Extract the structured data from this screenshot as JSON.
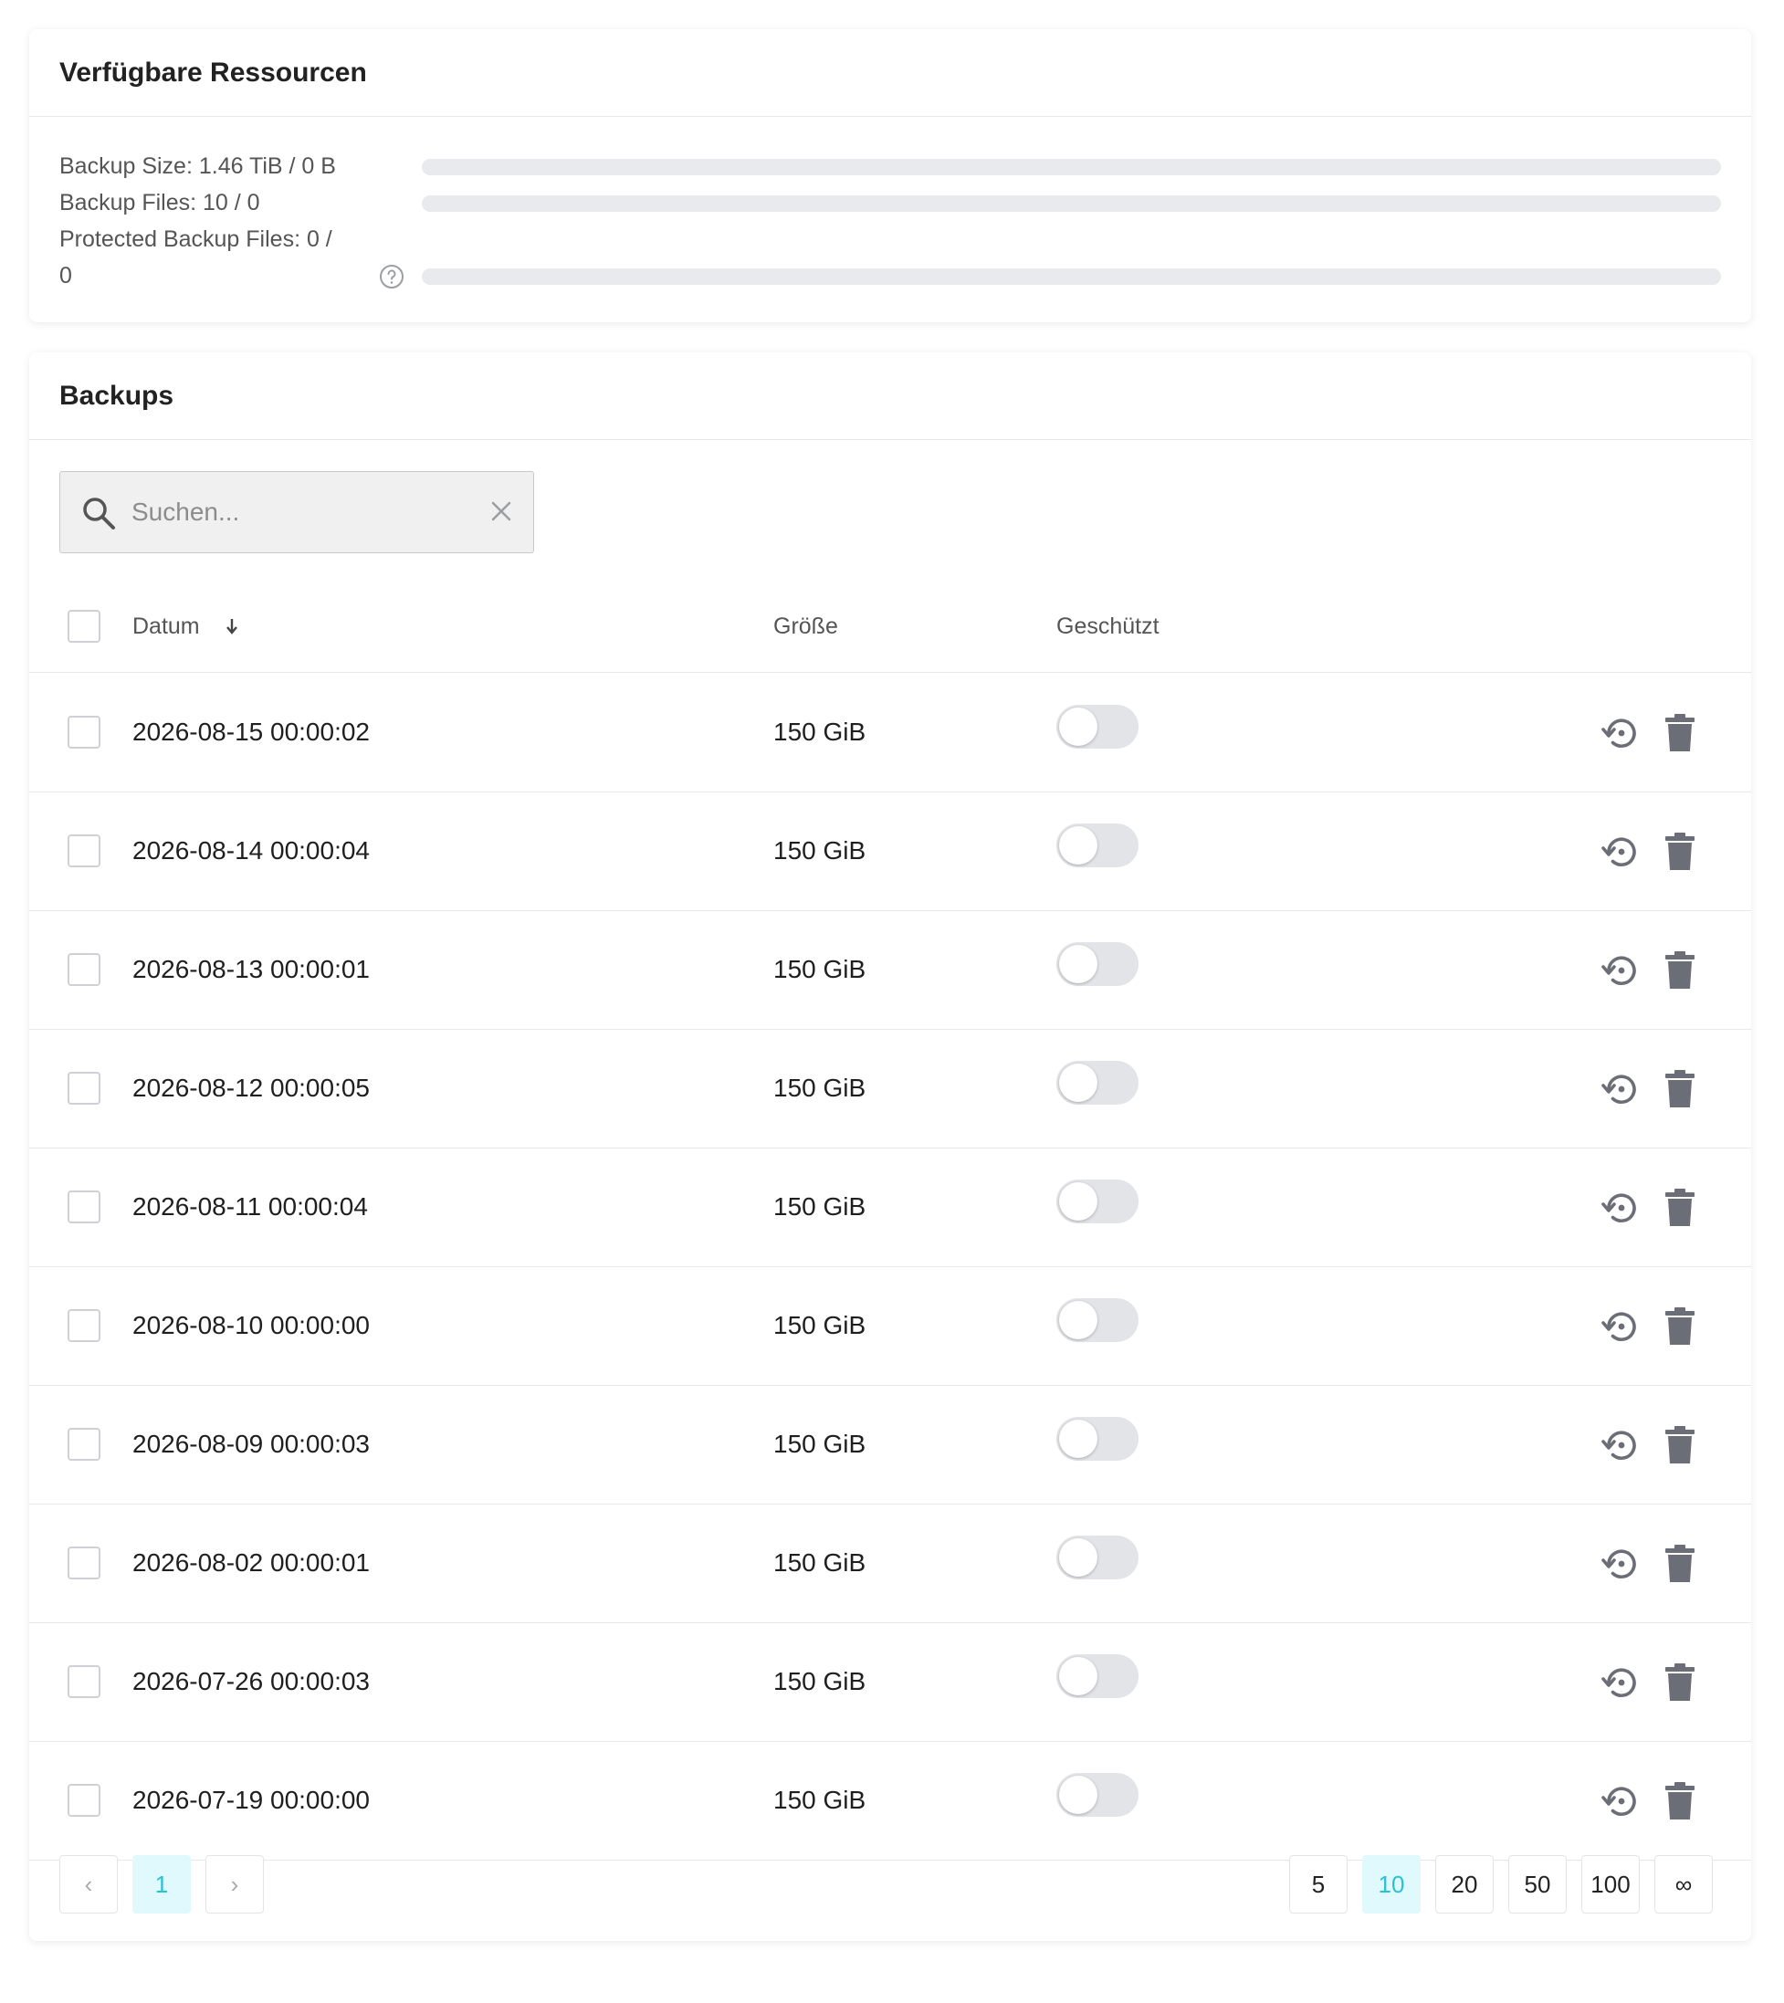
{
  "resources": {
    "title": "Verfügbare Ressourcen",
    "rows": [
      {
        "label": "Backup Size: 1.46 TiB / 0 B",
        "fill": 0
      },
      {
        "label": "Backup Files: 10 / 0",
        "fill": 0
      },
      {
        "label": "Protected Backup Files: 0 / 0",
        "fill": 0,
        "help_icon": "help-circle-icon"
      }
    ]
  },
  "backups": {
    "title": "Backups",
    "search": {
      "placeholder": "Suchen...",
      "icon": "search-icon",
      "clear_icon": "close-icon"
    },
    "columns": {
      "date": "Datum",
      "size": "Größe",
      "protected": "Geschützt",
      "sort_icon": "arrow-down-icon"
    },
    "rows": [
      {
        "date": "2026-08-15 00:00:02",
        "size": "150 GiB",
        "protected": false
      },
      {
        "date": "2026-08-14 00:00:04",
        "size": "150 GiB",
        "protected": false
      },
      {
        "date": "2026-08-13 00:00:01",
        "size": "150 GiB",
        "protected": false
      },
      {
        "date": "2026-08-12 00:00:05",
        "size": "150 GiB",
        "protected": false
      },
      {
        "date": "2026-08-11 00:00:04",
        "size": "150 GiB",
        "protected": false
      },
      {
        "date": "2026-08-10 00:00:00",
        "size": "150 GiB",
        "protected": false
      },
      {
        "date": "2026-08-09 00:00:03",
        "size": "150 GiB",
        "protected": false
      },
      {
        "date": "2026-08-02 00:00:01",
        "size": "150 GiB",
        "protected": false
      },
      {
        "date": "2026-07-26 00:00:03",
        "size": "150 GiB",
        "protected": false
      },
      {
        "date": "2026-07-19 00:00:00",
        "size": "150 GiB",
        "protected": false
      }
    ],
    "row_icons": {
      "restore": "restore-icon",
      "delete": "trash-icon"
    },
    "pagination": {
      "prev": "‹",
      "next": "›",
      "current_page": "1",
      "page_sizes": [
        "5",
        "10",
        "20",
        "50",
        "100",
        "∞"
      ],
      "selected_page_size": "10"
    }
  },
  "colors": {
    "accent": "#2bc0d8",
    "accent_bg": "#dff9fc",
    "track": "#e9eaee",
    "icon": "#6b6e76"
  }
}
